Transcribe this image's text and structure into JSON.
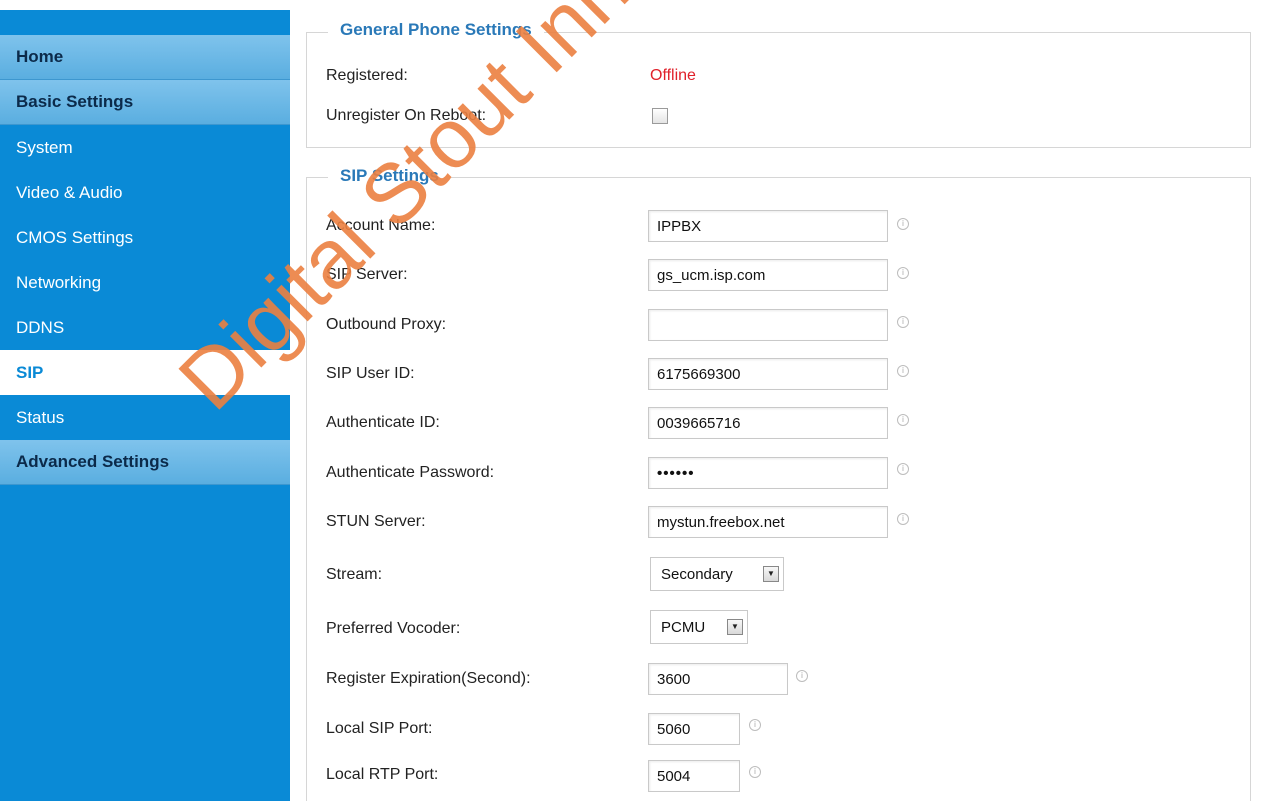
{
  "sidebar": {
    "items": [
      {
        "label": "Home"
      },
      {
        "label": "Basic Settings"
      },
      {
        "label": "System"
      },
      {
        "label": "Video & Audio"
      },
      {
        "label": "CMOS Settings"
      },
      {
        "label": "Networking"
      },
      {
        "label": "DDNS"
      },
      {
        "label": "SIP"
      },
      {
        "label": "Status"
      },
      {
        "label": "Advanced Settings"
      }
    ]
  },
  "general": {
    "legend": "General Phone Settings",
    "registered_label": "Registered:",
    "registered_value": "Offline",
    "unregister_label": "Unregister On Reboot:",
    "unregister_checked": false
  },
  "sip": {
    "legend": "SIP Settings",
    "account_name_label": "Account Name:",
    "account_name_value": "IPPBX",
    "sip_server_label": "SIP Server:",
    "sip_server_value": "gs_ucm.isp.com",
    "outbound_proxy_label": "Outbound Proxy:",
    "outbound_proxy_value": "",
    "sip_user_id_label": "SIP User ID:",
    "sip_user_id_value": "6175669300",
    "auth_id_label": "Authenticate ID:",
    "auth_id_value": "0039665716",
    "auth_password_label": "Authenticate Password:",
    "auth_password_value": "••••••",
    "stun_label": "STUN Server:",
    "stun_value": "mystun.freebox.net",
    "stream_label": "Stream:",
    "stream_value": "Secondary",
    "vocoder_label": "Preferred Vocoder:",
    "vocoder_value": "PCMU",
    "reg_exp_label": "Register Expiration(Second):",
    "reg_exp_value": "3600",
    "local_sip_port_label": "Local SIP Port:",
    "local_sip_port_value": "5060",
    "local_rtp_port_label": "Local RTP Port:",
    "local_rtp_port_value": "5004"
  },
  "colors": {
    "sidebar_bg": "#0a8ad6",
    "legend_text": "#2a79b8",
    "offline_text": "#e0202a"
  },
  "watermark": "Digital Stout Innovation & Te"
}
